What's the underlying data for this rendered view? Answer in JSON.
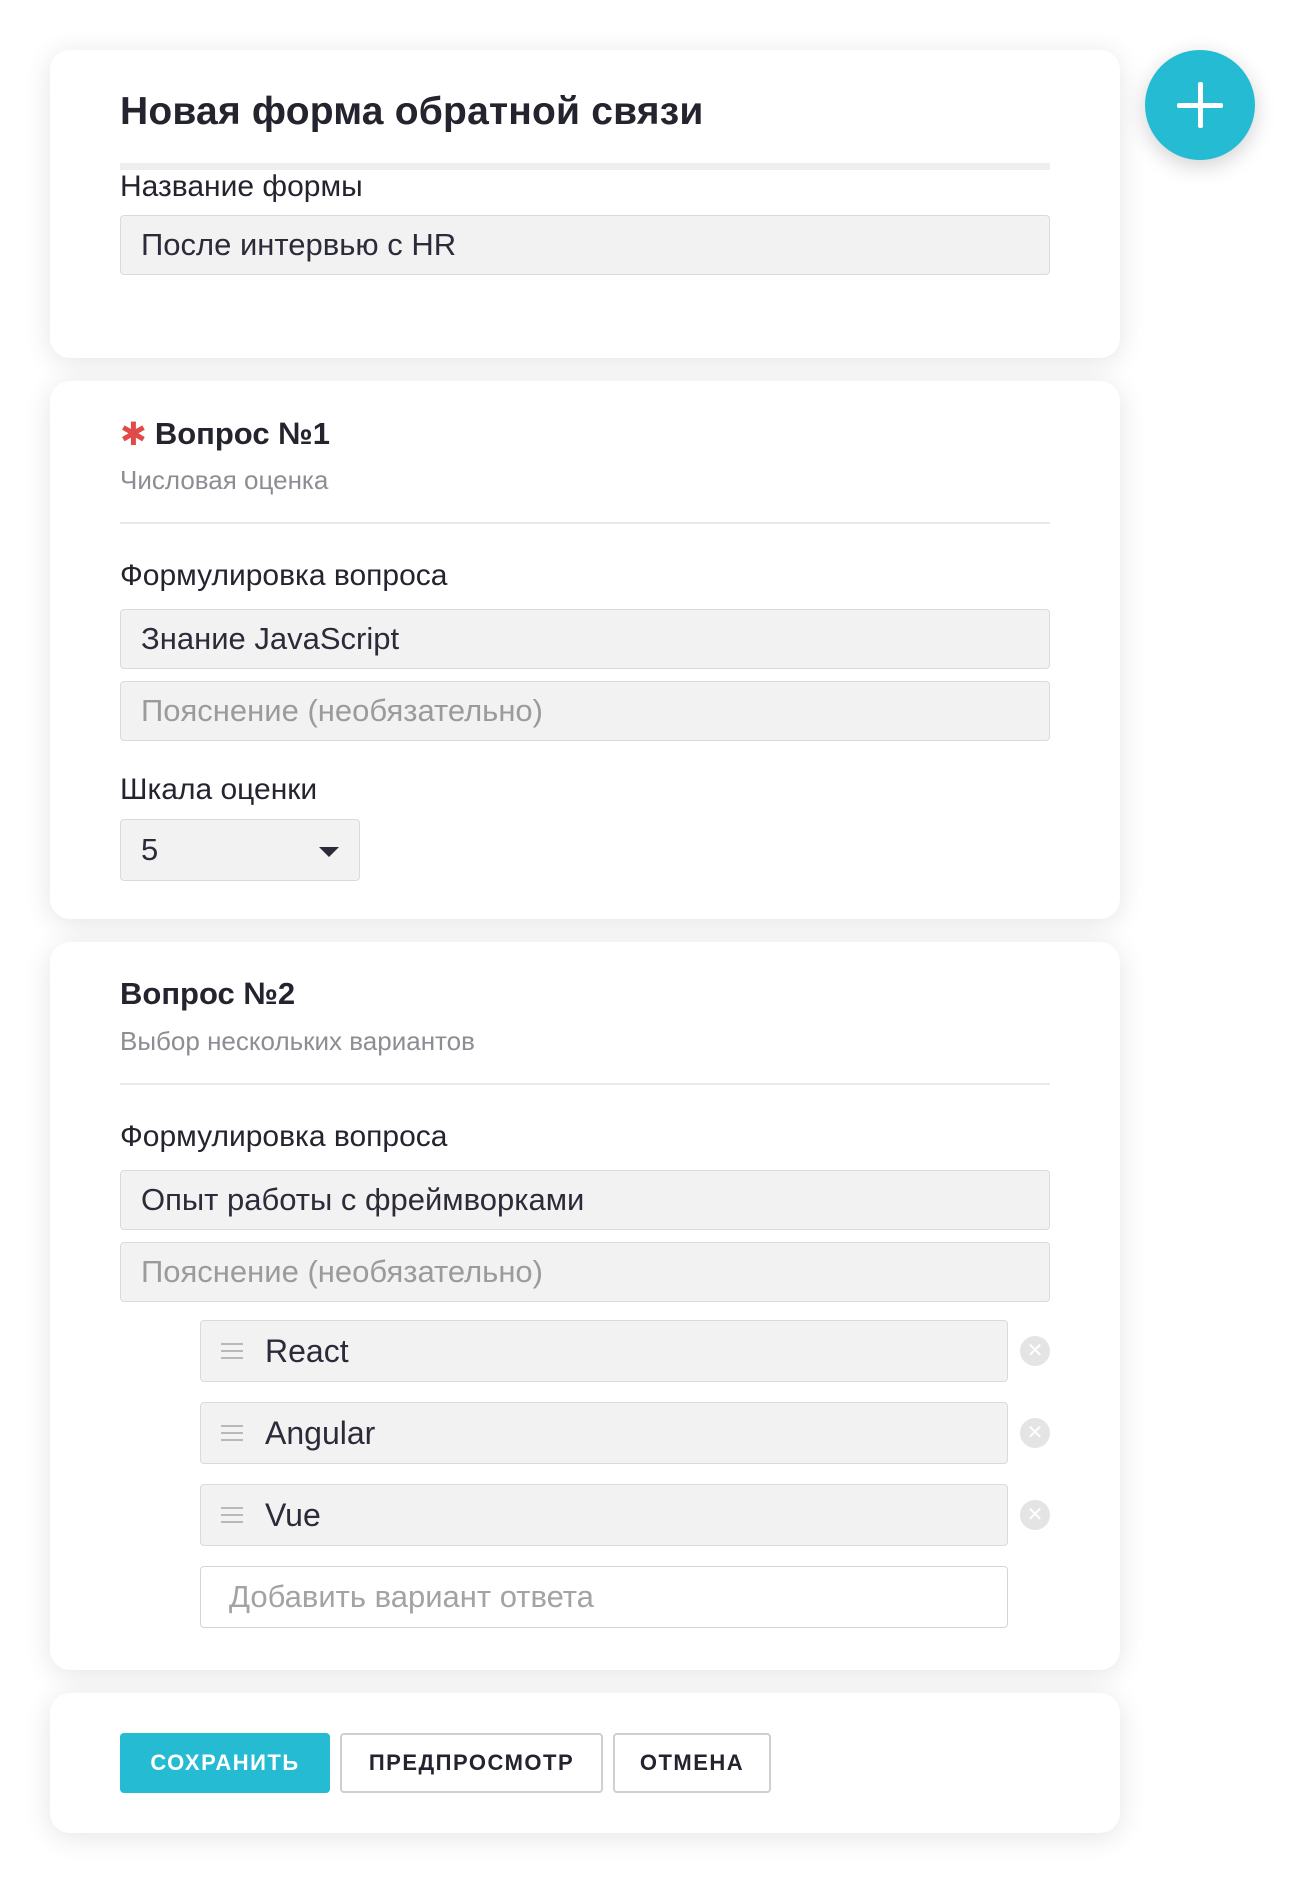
{
  "header": {
    "title": "Новая форма обратной связи",
    "form_name_label": "Название формы",
    "form_name_value": "После интервью с HR"
  },
  "question1": {
    "title": "Вопрос №1",
    "required": true,
    "type": "Числовая оценка",
    "wording_label": "Формулировка вопроса",
    "wording_value": "Знание JavaScript",
    "hint_placeholder": "Пояснение (необязательно)",
    "scale_label": "Шкала оценки",
    "scale_value": "5"
  },
  "question2": {
    "title": "Вопрос №2",
    "type": "Выбор нескольких вариантов",
    "wording_label": "Формулировка вопроса",
    "wording_value": "Опыт работы с фреймворками",
    "hint_placeholder": "Пояснение (необязательно)",
    "options": [
      {
        "label": "React"
      },
      {
        "label": "Angular"
      },
      {
        "label": "Vue"
      }
    ],
    "add_option_placeholder": "Добавить вариант ответа"
  },
  "actions": {
    "save_label": "СОХРАНИТЬ",
    "preview_label": "ПРЕДПРОСМОТР",
    "cancel_label": "ОТМЕНА"
  },
  "icons": {
    "add": "plus-icon",
    "required": "asterisk-icon",
    "dropdown": "chevron-down-icon",
    "drag": "drag-handle-icon",
    "remove": "close-icon"
  },
  "colors": {
    "accent": "#25bcd3",
    "required": "#e04a4a",
    "field_bg": "#f2f2f2"
  }
}
